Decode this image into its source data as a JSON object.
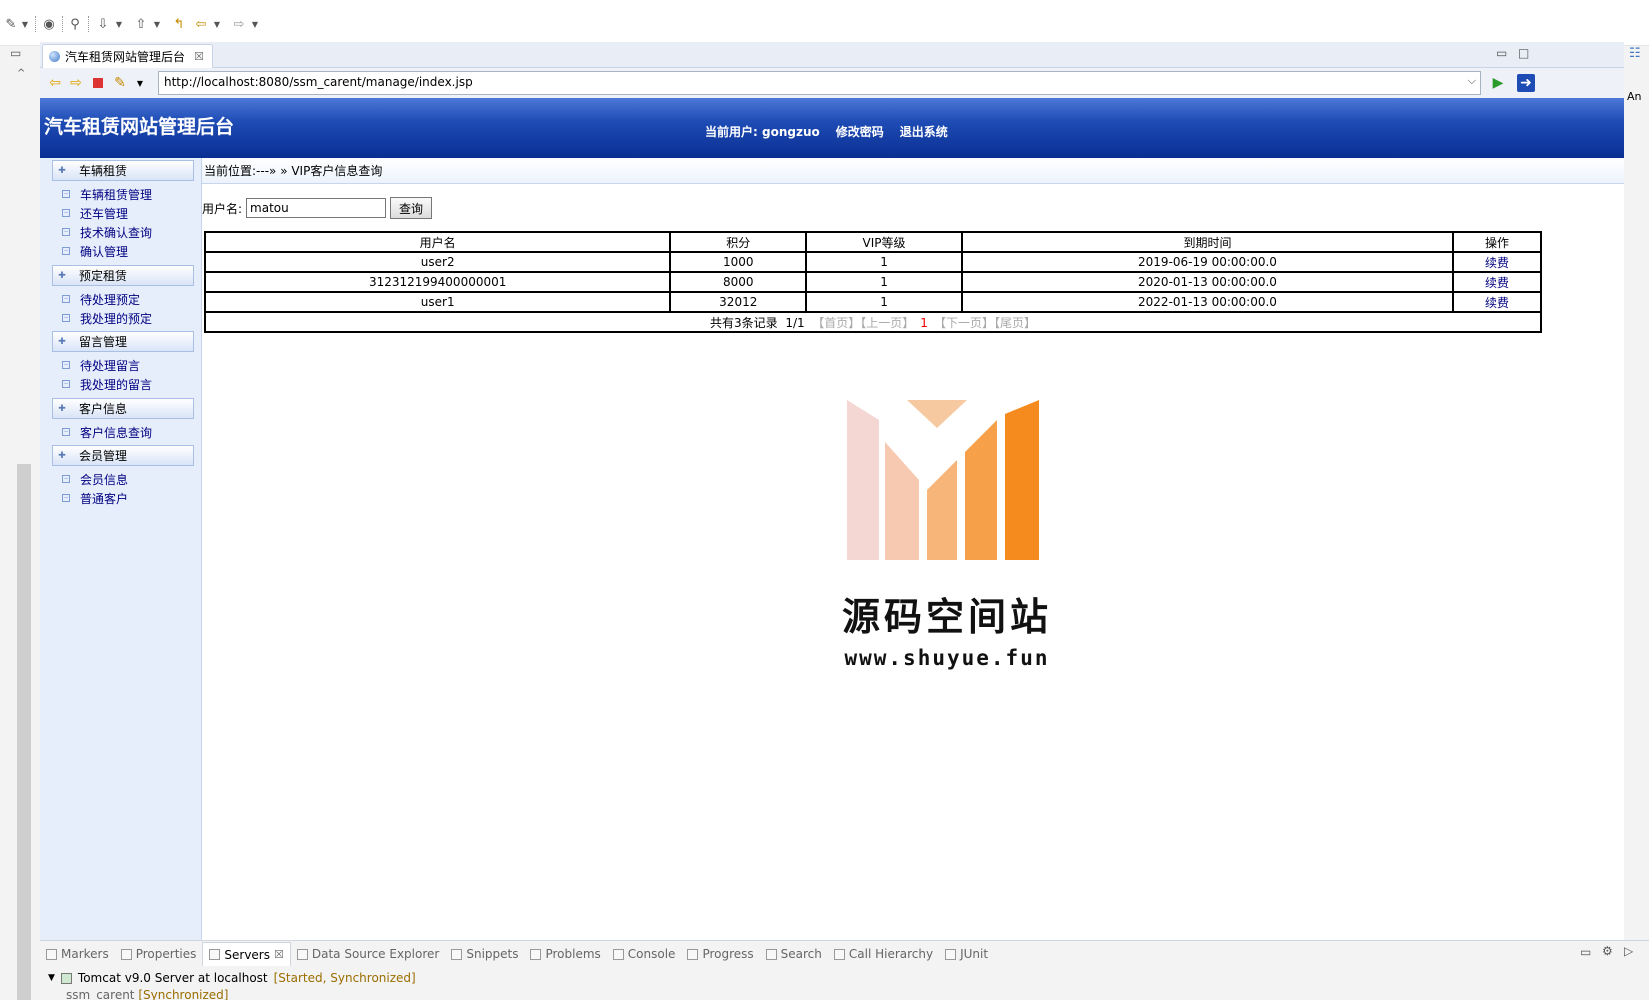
{
  "ide": {
    "editor_tab_title": "汽车租赁网站管理后台",
    "tab_close": "☒",
    "minimize": "▭",
    "maximize": "□",
    "right_label": "An",
    "url": "http://localhost:8080/ssm_carent/manage/index.jsp"
  },
  "site": {
    "title": "汽车租赁网站管理后台",
    "current_user_label": "当前用户:",
    "current_user": "gongzuo",
    "change_password": "修改密码",
    "logout": "退出系统"
  },
  "menu": {
    "groups": [
      {
        "label": "车辆租赁",
        "items": [
          "车辆租赁管理",
          "还车管理",
          "技术确认查询",
          "确认管理"
        ]
      },
      {
        "label": "预定租赁",
        "items": [
          "待处理预定",
          "我处理的预定"
        ]
      },
      {
        "label": "留言管理",
        "items": [
          "待处理留言",
          "我处理的留言"
        ]
      },
      {
        "label": "客户信息",
        "items": [
          "客户信息查询"
        ]
      },
      {
        "label": "会员管理",
        "items": [
          "会员信息",
          "普通客户"
        ]
      }
    ]
  },
  "content": {
    "breadcrumb": "当前位置:---» » VIP客户信息查询",
    "search_label": "用户名:",
    "search_value": "matou",
    "search_button": "查询",
    "columns": [
      "用户名",
      "积分",
      "VIP等级",
      "到期时间",
      "操作"
    ],
    "rows": [
      {
        "username": "user2",
        "points": "1000",
        "vip": "1",
        "expire": "2019-06-19 00:00:00.0",
        "op": "续费"
      },
      {
        "username": "312312199400000001",
        "points": "8000",
        "vip": "1",
        "expire": "2020-01-13 00:00:00.0",
        "op": "续费"
      },
      {
        "username": "user1",
        "points": "32012",
        "vip": "1",
        "expire": "2022-01-13 00:00:00.0",
        "op": "续费"
      }
    ],
    "pager": {
      "total": "共有3条记录",
      "pages": "1/1",
      "first": "【首页】",
      "prev": "【上一页】",
      "current": "1",
      "next": "【下一页】",
      "last": "【尾页】"
    }
  },
  "watermark": {
    "name": "源码空间站",
    "url": "www.shuyue.fun"
  },
  "bottom": {
    "tabs": [
      "Markers",
      "Properties",
      "Servers",
      "Data Source Explorer",
      "Snippets",
      "Problems",
      "Console",
      "Progress",
      "Search",
      "Call Hierarchy",
      "JUnit"
    ],
    "active_tab": "Servers",
    "server": "Tomcat v9.0 Server at localhost",
    "server_status": "[Started, Synchronized]",
    "module": "ssm_carent",
    "module_status": "[Synchronized]"
  }
}
